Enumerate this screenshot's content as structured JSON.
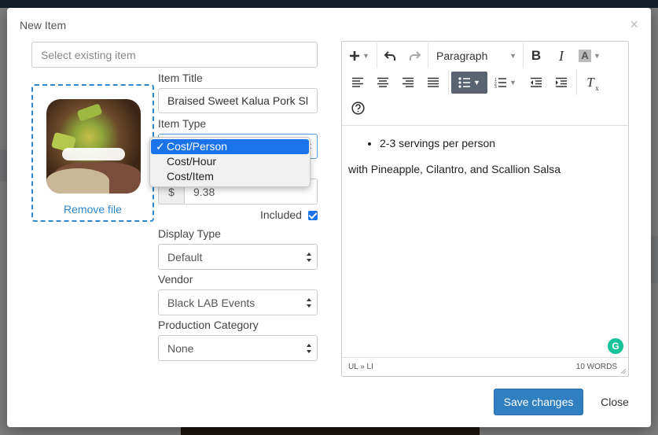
{
  "modal": {
    "title": "New Item",
    "close_glyph": "×"
  },
  "existing_item": {
    "placeholder": "Select existing item"
  },
  "image": {
    "remove_label": "Remove file"
  },
  "item_title": {
    "label": "Item Title",
    "value": "Braised Sweet Kalua Pork Sl"
  },
  "item_type": {
    "label": "Item Type",
    "options": [
      "Cost/Person",
      "Cost/Hour",
      "Cost/Item"
    ],
    "selected": "Cost/Person",
    "check": "✓"
  },
  "price": {
    "currency": "$",
    "value": "9.38"
  },
  "included": {
    "label": "Included",
    "checked": true
  },
  "display_type": {
    "label": "Display Type",
    "value": "Default"
  },
  "vendor": {
    "label": "Vendor",
    "value": "Black LAB Events"
  },
  "production_category": {
    "label": "Production Category",
    "value": "None"
  },
  "editor": {
    "paragraph_label": "Paragraph",
    "bullets": [
      "2-3 servings per person"
    ],
    "paragraph": "with Pineapple, Cilantro, and Scallion Salsa",
    "path": "UL » LI",
    "word_count": "10 WORDS",
    "grammarly": "G"
  },
  "footer": {
    "save_label": "Save changes",
    "close_label": "Close"
  },
  "icons": [
    "plus-icon",
    "undo-icon",
    "redo-icon",
    "bold-icon",
    "italic-icon",
    "font-color-icon",
    "align-left-icon",
    "align-center-icon",
    "align-right-icon",
    "align-justify-icon",
    "bullet-list-icon",
    "numbered-list-icon",
    "outdent-icon",
    "indent-icon",
    "clear-format-icon",
    "help-icon"
  ],
  "colors": {
    "accent": "#2f7fc1",
    "dropdown_selected": "#1a73e8",
    "dashed_border": "#2f86c9"
  }
}
